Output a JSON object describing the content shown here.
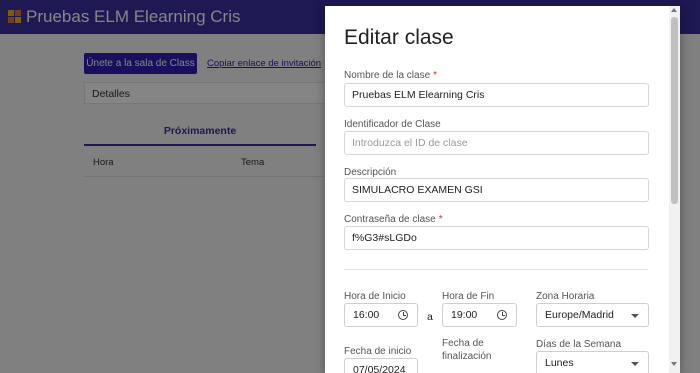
{
  "app": {
    "title": "Pruebas ELM Elearning Cris"
  },
  "page": {
    "join_button": "Únete a la sala de Class",
    "copy_link": "Copiar enlace de invitación",
    "details_label": "Detalles",
    "upcoming_tab": "Próximamente",
    "columns": [
      "Hora",
      "Tema"
    ]
  },
  "modal": {
    "title": "Editar clase",
    "class_name": {
      "label": "Nombre de la clase",
      "required": "*",
      "value": "Pruebas ELM Elearning Cris"
    },
    "class_id": {
      "label": "Identificador de Clase",
      "placeholder": "Introduzca el ID de clase"
    },
    "description": {
      "label": "Descripción",
      "value": "SIMULACRO EXAMEN GSI"
    },
    "password": {
      "label": "Contraseña de clase",
      "required": "*",
      "value": "f%G3#sLGDo"
    },
    "start_time": {
      "label": "Hora de Inicio",
      "value": "16:00"
    },
    "separator": "a",
    "end_time": {
      "label": "Hora de Fin",
      "value": "19:00"
    },
    "timezone": {
      "label": "Zona Horaria",
      "value": "Europe/Madrid"
    },
    "start_date": {
      "label": "Fecha de inicio",
      "value": "07/05/2024"
    },
    "end_date": {
      "label_line1": "Fecha de",
      "label_line2": "finalización"
    },
    "weekdays": {
      "label": "Días de la Semana",
      "value": "Lunes"
    }
  },
  "colors": {
    "appbar": "#3a2fa0",
    "primary_button": "#2e20b5",
    "required": "#d32f2f"
  },
  "icons": [
    "logo-icon",
    "clock-icon",
    "dropdown-caret-icon",
    "scroll-up-icon",
    "scroll-down-icon"
  ]
}
